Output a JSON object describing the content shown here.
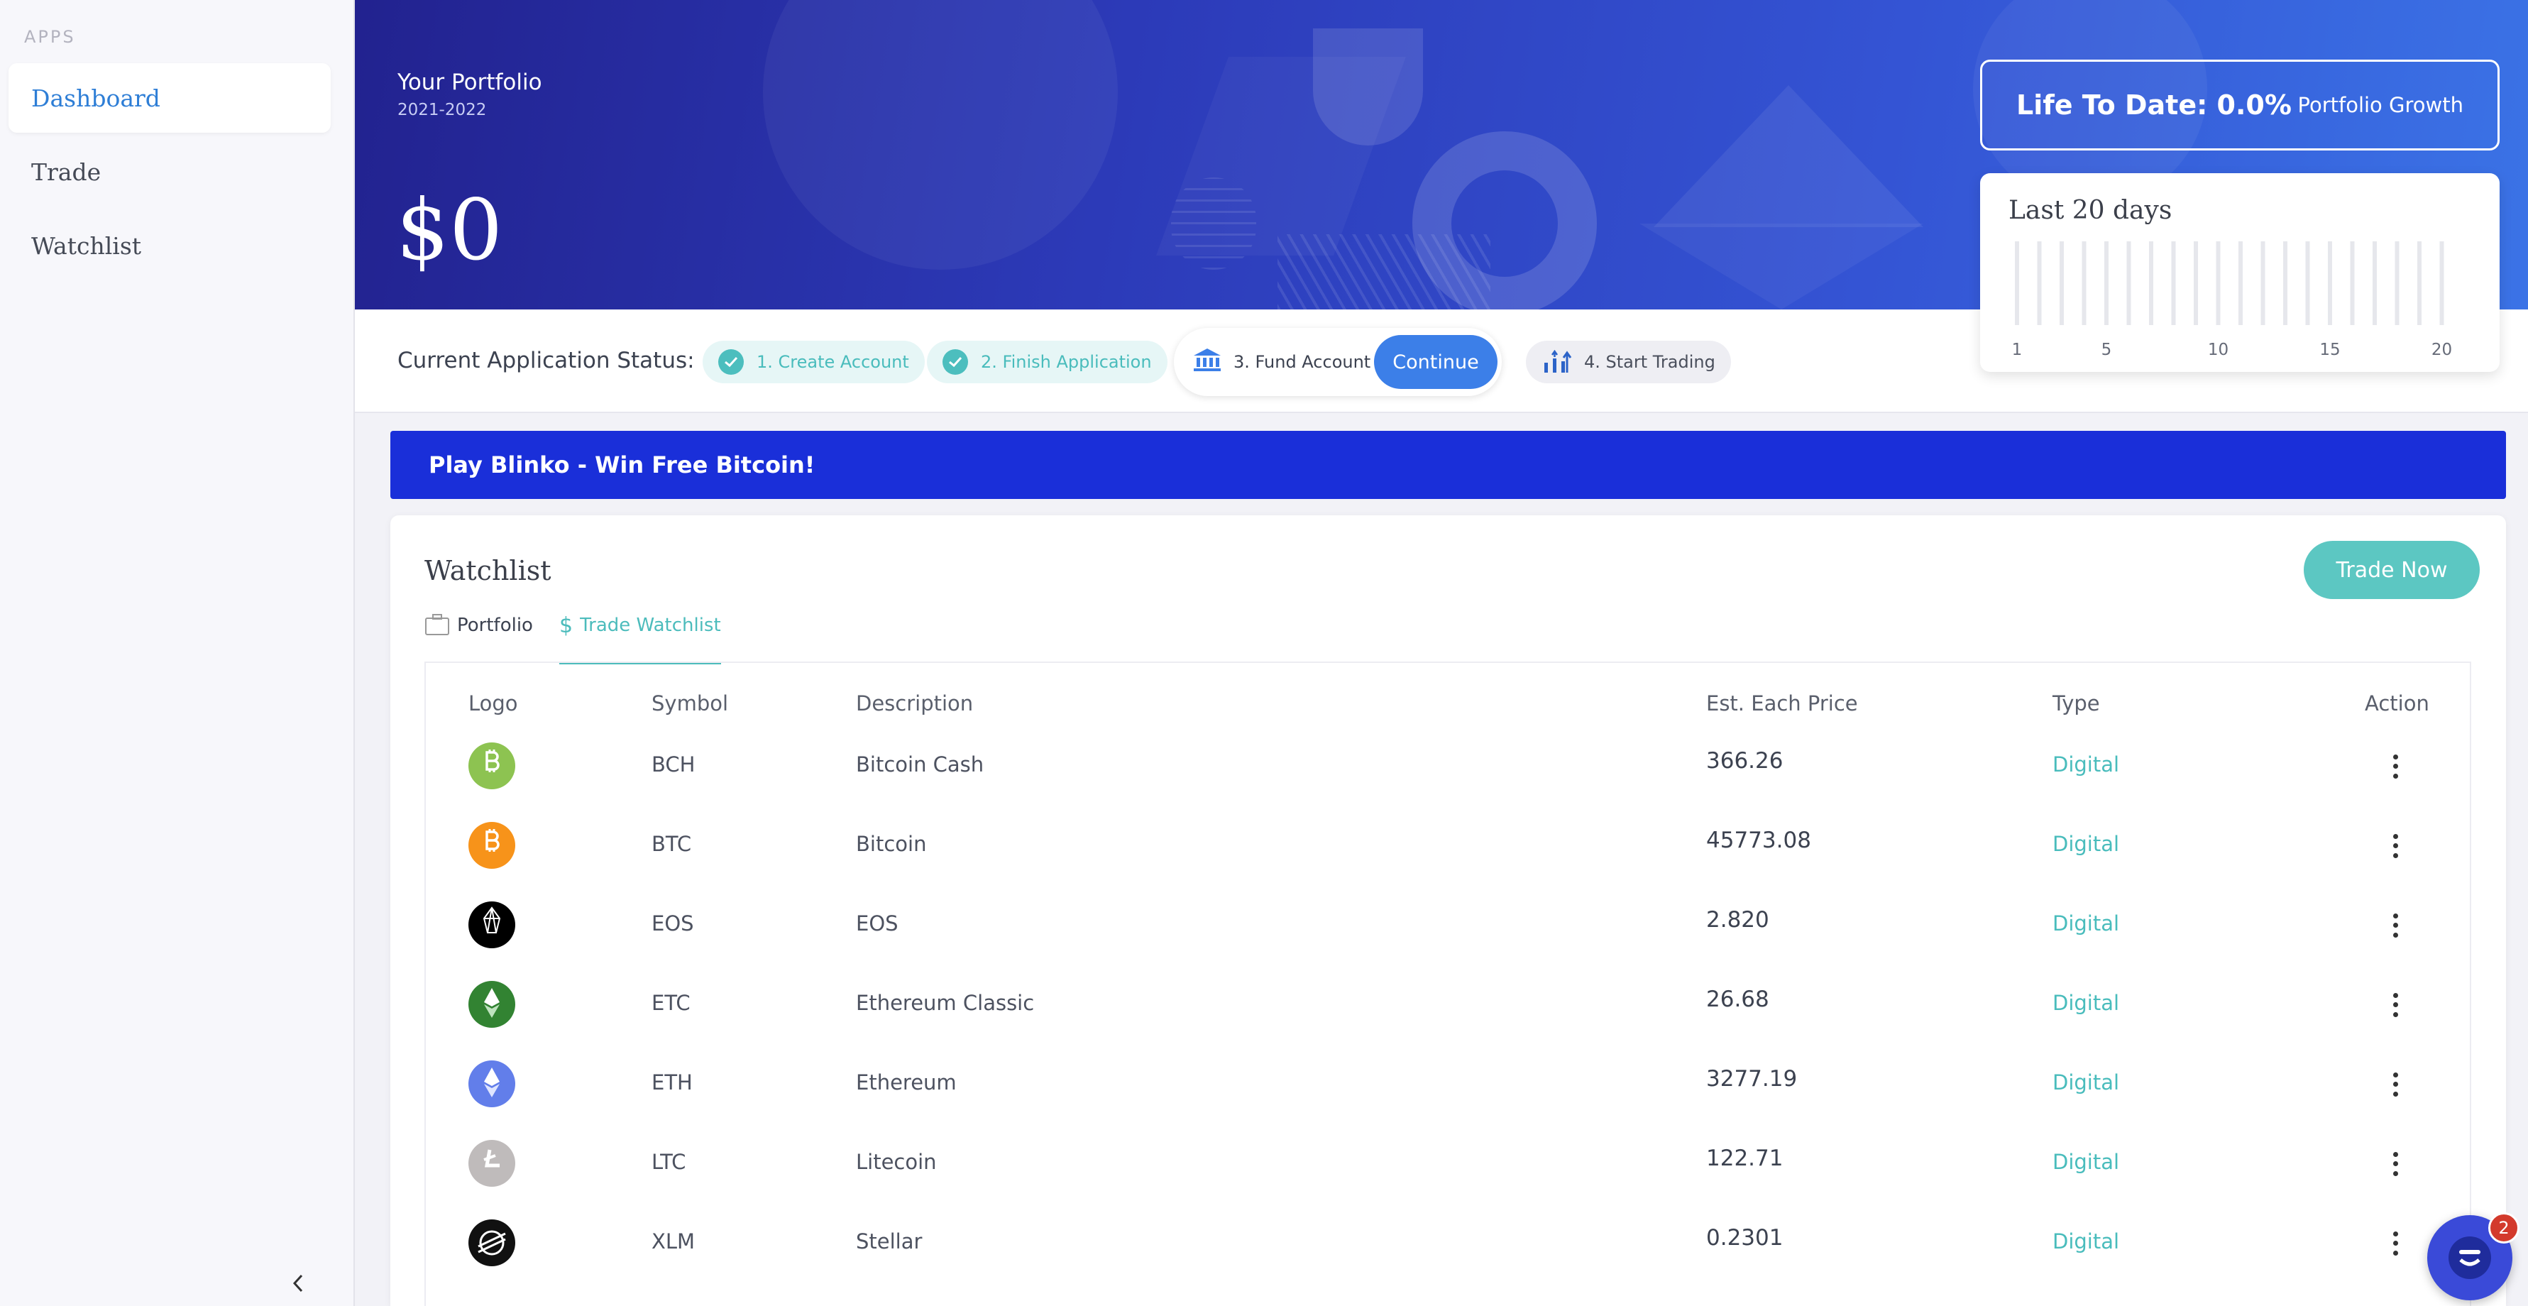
{
  "sidebar": {
    "section_label": "APPS",
    "items": [
      {
        "label": "Dashboard",
        "active": true
      },
      {
        "label": "Trade",
        "active": false
      },
      {
        "label": "Watchlist",
        "active": false
      }
    ],
    "collapse_icon": "chevron-left-icon"
  },
  "hero": {
    "title": "Your Portfolio",
    "subtitle": "2021-2022",
    "amount": "$0",
    "life_to_date": "Life To Date: 0.0%",
    "growth_label": "Portfolio Growth",
    "last_days": {
      "title": "Last 20 days",
      "tick_labels": [
        "1",
        "5",
        "10",
        "15",
        "20"
      ]
    }
  },
  "status": {
    "label": "Current Application Status:",
    "steps": [
      {
        "label": "1. Create Account",
        "state": "done",
        "icon": "check-icon"
      },
      {
        "label": "2. Finish Application",
        "state": "done",
        "icon": "check-icon"
      },
      {
        "label": "3. Fund Account",
        "state": "current",
        "icon": "bank-icon"
      },
      {
        "label": "4. Start Trading",
        "state": "pending",
        "icon": "chart-arrows-icon"
      }
    ],
    "continue_label": "Continue"
  },
  "banner": {
    "text": "Play Blinko - Win Free Bitcoin!"
  },
  "watchlist": {
    "title": "Watchlist",
    "trade_now_label": "Trade Now",
    "tabs": [
      {
        "label": "Portfolio",
        "icon": "briefcase-icon",
        "active": false
      },
      {
        "label": "Trade Watchlist",
        "icon": "dollar-icon",
        "active": true
      }
    ],
    "columns": [
      "Logo",
      "Symbol",
      "Description",
      "Est. Each Price",
      "Type",
      "Action"
    ],
    "rows": [
      {
        "symbol": "BCH",
        "description": "Bitcoin Cash",
        "price": "366.26",
        "type": "Digital",
        "logo_color": "#8dc351",
        "logo_icon": "bitcoin-cash-icon"
      },
      {
        "symbol": "BTC",
        "description": "Bitcoin",
        "price": "45773.08",
        "type": "Digital",
        "logo_color": "#f7931a",
        "logo_icon": "bitcoin-icon"
      },
      {
        "symbol": "EOS",
        "description": "EOS",
        "price": "2.820",
        "type": "Digital",
        "logo_color": "#000000",
        "logo_icon": "eos-icon"
      },
      {
        "symbol": "ETC",
        "description": "Ethereum Classic",
        "price": "26.68",
        "type": "Digital",
        "logo_color": "#328332",
        "logo_icon": "ethereum-classic-icon"
      },
      {
        "symbol": "ETH",
        "description": "Ethereum",
        "price": "3277.19",
        "type": "Digital",
        "logo_color": "#627eea",
        "logo_icon": "ethereum-icon"
      },
      {
        "symbol": "LTC",
        "description": "Litecoin",
        "price": "122.71",
        "type": "Digital",
        "logo_color": "#bfbbbb",
        "logo_icon": "litecoin-icon"
      },
      {
        "symbol": "XLM",
        "description": "Stellar",
        "price": "0.2301",
        "type": "Digital",
        "logo_color": "#111111",
        "logo_icon": "stellar-icon"
      }
    ]
  },
  "chat": {
    "badge_count": "2",
    "icon": "chat-icon"
  },
  "colors": {
    "accent": "#2e7ed6",
    "teal": "#4cbcbc",
    "banner": "#1a2fd9",
    "continue": "#3c7fe8"
  }
}
